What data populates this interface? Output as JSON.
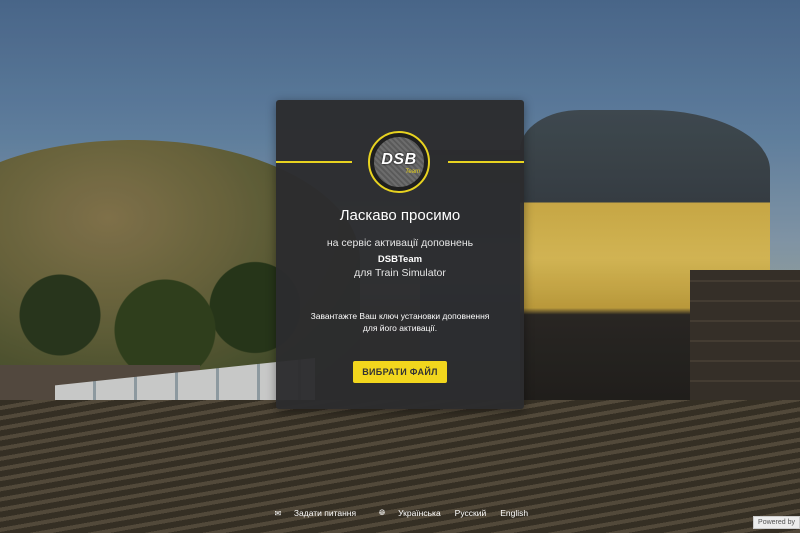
{
  "card": {
    "logo_text": "DSB",
    "logo_sub": "Team",
    "title": "Ласкаво просимо",
    "subtitle": "на сервіс активації доповнень",
    "brand": "DSBTeam",
    "product": "для Train Simulator",
    "instruction_line1": "Завантажте Ваш ключ установки доповнення",
    "instruction_line2": "для його активації.",
    "button_label": "ВИБРАТИ ФАЙЛ"
  },
  "footer": {
    "contact_label": "Задати питання",
    "languages": [
      "Українська",
      "Русский",
      "English"
    ]
  },
  "powered_by": "Powered by",
  "icons": {
    "contact": "mail-icon",
    "language": "globe-icon"
  },
  "colors": {
    "accent": "#f2d61d",
    "card_bg": "#2c2c2e"
  }
}
